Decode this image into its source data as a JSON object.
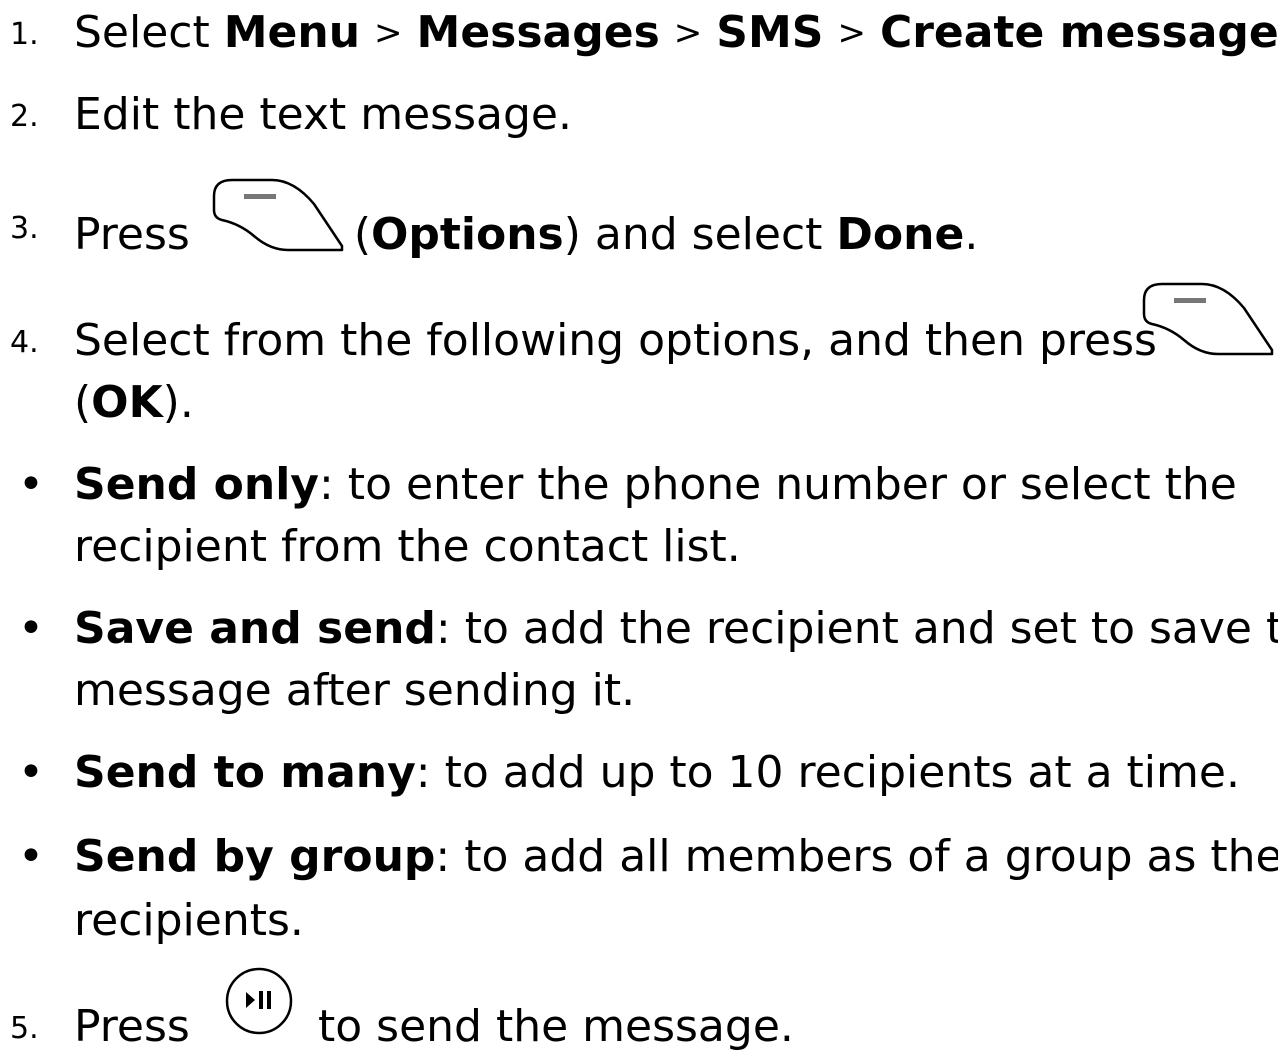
{
  "steps": [
    {
      "number": "1.",
      "prefix": "Select",
      "path": [
        "Menu",
        "Messages",
        "SMS",
        "Create message"
      ],
      "separator": ">",
      "suffix": "."
    },
    {
      "number": "2.",
      "text": "Edit the text message."
    },
    {
      "number": "3.",
      "prefix": "Press",
      "key_icon": "left-soft-key-icon",
      "open_paren": "(",
      "key_name": "Options",
      "middle": ") and select",
      "target": "Done",
      "suffix": "."
    },
    {
      "number": "4.",
      "text": "Select from the following options, and then press",
      "key_icon": "left-soft-key-icon",
      "open_paren": "(",
      "key_name": "OK",
      "close": ")."
    },
    {
      "number": "5.",
      "prefix": "Press",
      "key_icon": "play-pause-key-icon",
      "suffix": "to send the message."
    }
  ],
  "options": [
    {
      "bullet": "•",
      "term": "Send only",
      "line1": ": to enter the phone number or select the",
      "line2": "recipient from the contact list."
    },
    {
      "bullet": "•",
      "term": "Save and send",
      "line1": ": to add the recipient and set to save the",
      "line2": "message after sending it."
    },
    {
      "bullet": "•",
      "term": "Send to many",
      "line1": ": to add up to 10 recipients at a time."
    },
    {
      "bullet": "•",
      "term": "Send by group",
      "line1": ": to add all members of a group as the",
      "line2": "recipients."
    }
  ]
}
